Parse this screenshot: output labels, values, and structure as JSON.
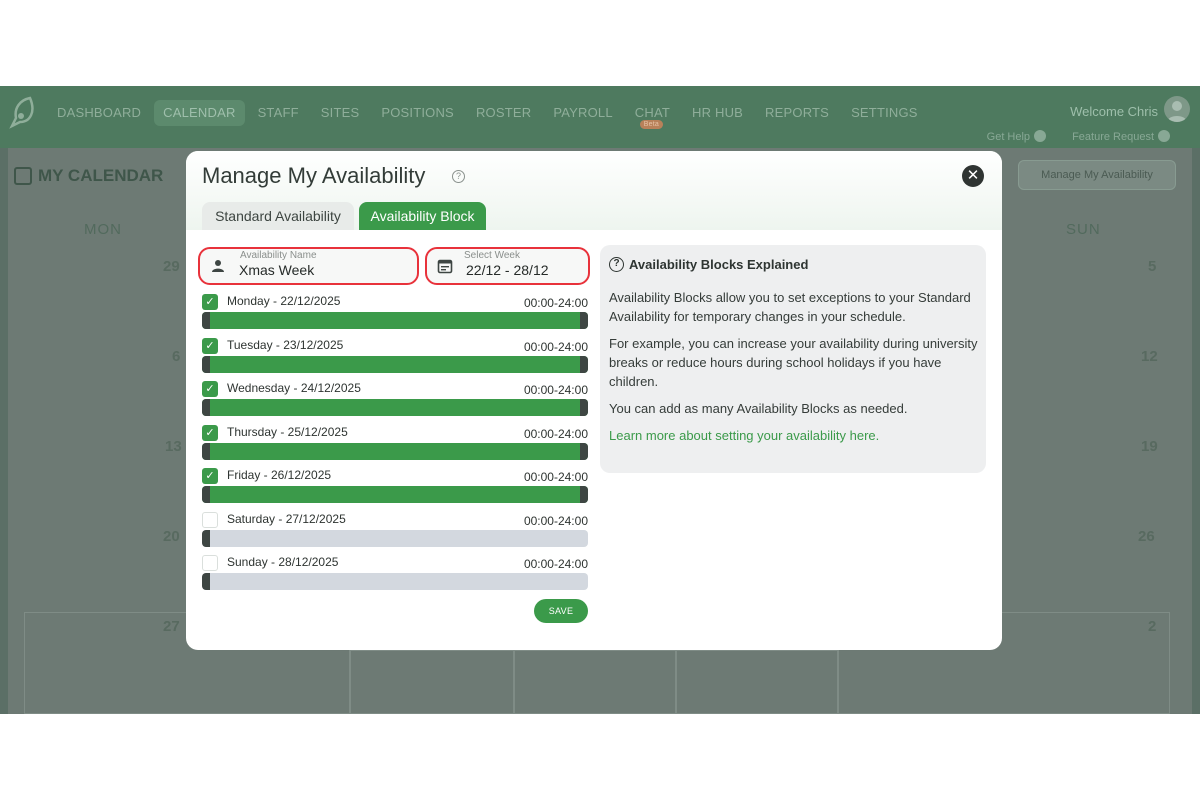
{
  "nav": {
    "items": [
      "DASHBOARD",
      "CALENDAR",
      "STAFF",
      "SITES",
      "POSITIONS",
      "ROSTER",
      "PAYROLL",
      "CHAT",
      "HR HUB",
      "REPORTS",
      "SETTINGS"
    ],
    "active": "CALENDAR",
    "chat_badge": "Beta",
    "welcome": "Welcome Chris",
    "get_help": "Get Help",
    "feature_request": "Feature Request"
  },
  "background": {
    "page_title": "MY CALENDAR",
    "manage_button": "Manage My Availability",
    "day_headers": {
      "mon": "MON",
      "sun": "SUN"
    },
    "dates_left": [
      "29",
      "6",
      "13",
      "20",
      "27"
    ],
    "dates_right": [
      "5",
      "12",
      "19",
      "26",
      "2"
    ]
  },
  "modal": {
    "title": "Manage My Availability",
    "tabs": {
      "standard": "Standard Availability",
      "block": "Availability Block"
    },
    "name_field": {
      "label": "Availability Name",
      "value": "Xmas Week"
    },
    "week_field": {
      "label": "Select Week",
      "value": "22/12 - 28/12"
    },
    "days": [
      {
        "label": "Monday - 22/12/2025",
        "time": "00:00-24:00",
        "checked": true,
        "fill": 1
      },
      {
        "label": "Tuesday - 23/12/2025",
        "time": "00:00-24:00",
        "checked": true,
        "fill": 1
      },
      {
        "label": "Wednesday - 24/12/2025",
        "time": "00:00-24:00",
        "checked": true,
        "fill": 1
      },
      {
        "label": "Thursday - 25/12/2025",
        "time": "00:00-24:00",
        "checked": true,
        "fill": 1
      },
      {
        "label": "Friday - 26/12/2025",
        "time": "00:00-24:00",
        "checked": true,
        "fill": 1
      },
      {
        "label": "Saturday - 27/12/2025",
        "time": "00:00-24:00",
        "checked": false,
        "fill": 0
      },
      {
        "label": "Sunday - 28/12/2025",
        "time": "00:00-24:00",
        "checked": false,
        "fill": 0
      }
    ],
    "save_label": "SAVE",
    "info": {
      "title": "Availability Blocks Explained",
      "p1": "Availability Blocks allow you to set exceptions to your Standard Availability for temporary changes in your schedule.",
      "p2": "For example, you can increase your availability during university breaks or reduce hours during school holidays if you have children.",
      "p3": "You can add as many Availability Blocks as needed.",
      "link": "Learn more about setting your availability here."
    }
  },
  "colors": {
    "accent": "#3b9a4a",
    "highlight": "#e8323b",
    "handle": "#3e4643",
    "track": "#d3d8df"
  }
}
